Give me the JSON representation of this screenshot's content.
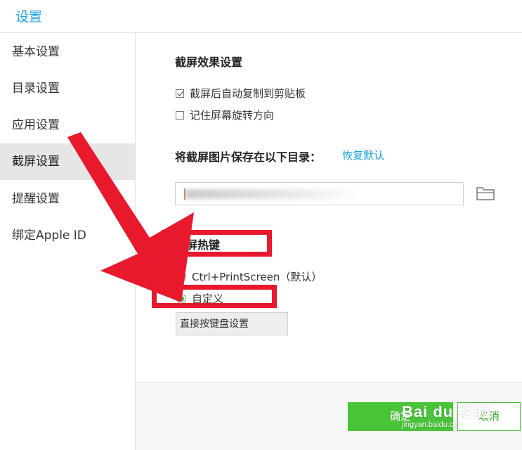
{
  "window": {
    "title": "设置"
  },
  "sidebar": {
    "items": [
      {
        "label": "基本设置",
        "active": false
      },
      {
        "label": "目录设置",
        "active": false
      },
      {
        "label": "应用设置",
        "active": false
      },
      {
        "label": "截屏设置",
        "active": true
      },
      {
        "label": "提醒设置",
        "active": false
      },
      {
        "label": "绑定Apple ID",
        "active": false
      }
    ]
  },
  "screenshot_effect": {
    "title": "截屏效果设置",
    "options": [
      {
        "label": "截屏后自动复制到剪贴板",
        "checked": true
      },
      {
        "label": "记住屏幕旋转方向",
        "checked": false
      }
    ]
  },
  "save_dir": {
    "title": "将截屏图片保存在以下目录：",
    "restore_label": "恢复默认",
    "path_value": "",
    "folder_icon": "folder-icon"
  },
  "hotkey": {
    "title": "截屏热键",
    "options": [
      {
        "label": "Ctrl+PrintScreen（默认）",
        "selected": false
      },
      {
        "label": "自定义",
        "selected": true
      }
    ],
    "input_label": "直接按键盘设置"
  },
  "footer": {
    "ok_label": "确定",
    "cancel_label": "取消"
  },
  "watermark": {
    "text": "Bai du 经验",
    "subtext": "jingyan.baidu.com"
  },
  "colors": {
    "accent_blue": "#1aa3e8",
    "ok_green": "#49c338",
    "annotation_red": "#e8192c",
    "radio_green": "#3cb82e"
  }
}
